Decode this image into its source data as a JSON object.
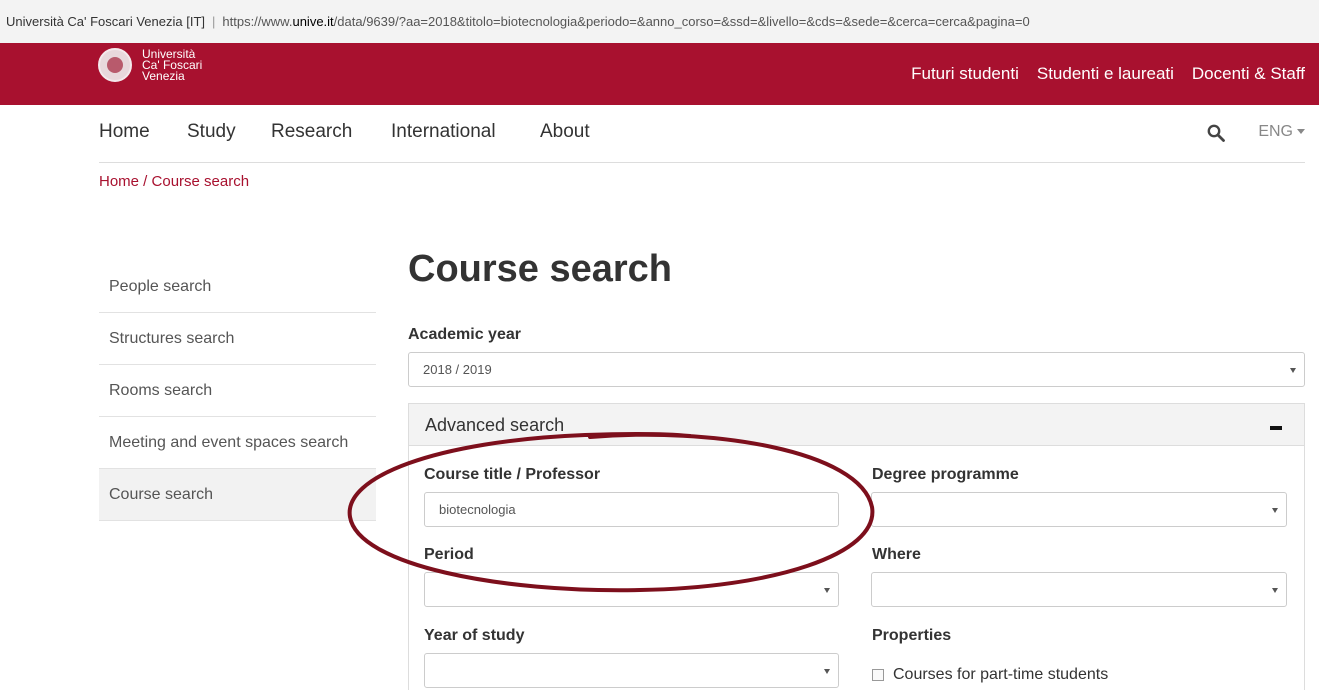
{
  "browser": {
    "site_label": "Università Ca' Foscari Venezia [IT]",
    "url_prefix": "https://www.",
    "url_domain": "unive.it",
    "url_path": "/data/9639/?aa=2018&titolo=biotecnologia&periodo=&anno_corso=&ssd=&livello=&cds=&sede=&cerca=cerca&pagina=0"
  },
  "brand": {
    "logo_line1": "Università",
    "logo_line2": "Ca' Foscari",
    "logo_line3": "Venezia",
    "color": "#a8112f"
  },
  "top_links": [
    "Futuri studenti",
    "Studenti e laureati",
    "Docenti & Staff"
  ],
  "nav": {
    "items": [
      "Home",
      "Study",
      "Research",
      "International",
      "About"
    ],
    "language": "ENG",
    "search_icon": "search-icon"
  },
  "breadcrumb": "Home / Course search",
  "side_menu": [
    "People search",
    "Structures search",
    "Rooms search",
    "Meeting and event spaces search",
    "Course search"
  ],
  "main": {
    "title": "Course search",
    "academic_year_label": "Academic year",
    "academic_year_value": "2018 / 2019",
    "advanced_title": "Advanced search",
    "fields": {
      "course_title_label": "Course title / Professor",
      "course_title_value": "biotecnologia",
      "degree_label": "Degree programme",
      "degree_value": "",
      "period_label": "Period",
      "period_value": "",
      "where_label": "Where",
      "where_value": "",
      "year_label": "Year of study",
      "year_value": "",
      "properties_label": "Properties",
      "part_time_label": "Courses for part-time students"
    }
  }
}
